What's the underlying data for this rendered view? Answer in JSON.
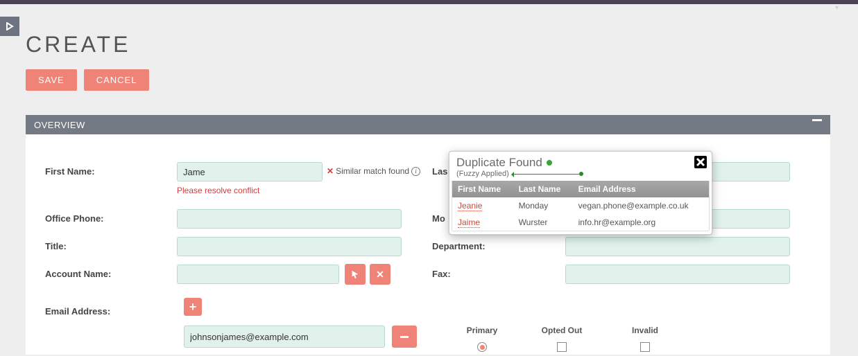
{
  "page": {
    "title": "CREATE"
  },
  "actions": {
    "save": "SAVE",
    "cancel": "CANCEL"
  },
  "panel": {
    "title": "OVERVIEW"
  },
  "labels": {
    "first_name": "First Name:",
    "last_name": "Las",
    "office_phone": "Office Phone:",
    "mobile": "Mo",
    "title": "Title:",
    "department": "Department:",
    "account_name": "Account Name:",
    "fax": "Fax:",
    "email_address": "Email Address:"
  },
  "values": {
    "first_name": "Jame",
    "email": "johnsonjames@example.com"
  },
  "match": {
    "text": "Similar match found",
    "conflict": "Please resolve conflict"
  },
  "email_cols": {
    "primary": "Primary",
    "opted_out": "Opted Out",
    "invalid": "Invalid"
  },
  "dup": {
    "title": "Duplicate Found",
    "sub": "(Fuzzy Applied)",
    "headers": {
      "fn": "First Name",
      "ln": "Last Name",
      "em": "Email Address"
    },
    "rows": [
      {
        "fn": "Jeanie",
        "ln": "Monday",
        "em": "vegan.phone@example.co.uk"
      },
      {
        "fn": "Jaime",
        "ln": "Wurster",
        "em": "info.hr@example.org"
      }
    ]
  }
}
